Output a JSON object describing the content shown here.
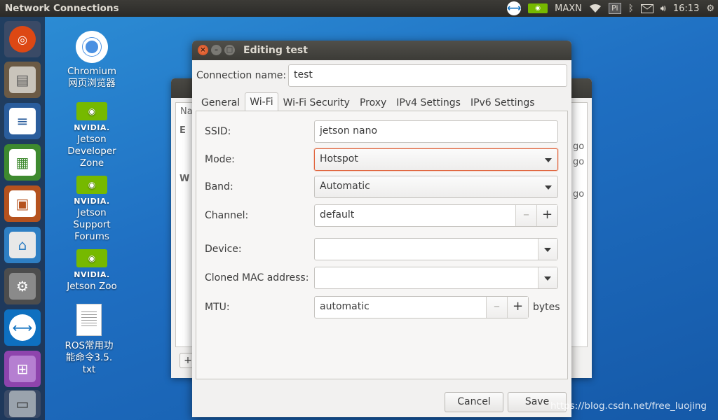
{
  "top_panel": {
    "app_title": "Network Connections",
    "nvidia_label": "MAXN",
    "pi_label": "Pi",
    "clock": "16:13"
  },
  "desktop": {
    "icons": [
      {
        "label": "Chromium\n网页浏览器"
      },
      {
        "brand": "NVIDIA.",
        "label": "Jetson\nDeveloper\nZone"
      },
      {
        "brand": "NVIDIA.",
        "label": "Jetson\nSupport\nForums"
      },
      {
        "brand": "NVIDIA.",
        "label": "Jetson Zoo"
      },
      {
        "label": "ROS常用功\n能命令3.5.\ntxt"
      }
    ]
  },
  "background_window": {
    "fragments": {
      "header": "Na",
      "group1": "E",
      "group2": "W",
      "ago1": "go",
      "ago2": "go",
      "ago3": "go",
      "add": "+"
    }
  },
  "dialog": {
    "title": "Editing test",
    "connection_name_label": "Connection name:",
    "connection_name_value": "test",
    "tabs": [
      "General",
      "Wi-Fi",
      "Wi-Fi Security",
      "Proxy",
      "IPv4 Settings",
      "IPv6 Settings"
    ],
    "active_tab": "Wi-Fi",
    "wifi": {
      "ssid_label": "SSID:",
      "ssid_value": "jetson nano",
      "mode_label": "Mode:",
      "mode_value": "Hotspot",
      "band_label": "Band:",
      "band_value": "Automatic",
      "channel_label": "Channel:",
      "channel_value": "default",
      "device_label": "Device:",
      "device_value": "",
      "mac_label": "Cloned MAC address:",
      "mac_value": "",
      "mtu_label": "MTU:",
      "mtu_value": "automatic",
      "mtu_unit": "bytes"
    },
    "cancel_label": "Cancel",
    "save_label": "Save"
  },
  "watermark": "https://blog.csdn.net/free_luojing",
  "colors": {
    "accent": "#e0623a",
    "nvidia_green": "#76b900"
  }
}
